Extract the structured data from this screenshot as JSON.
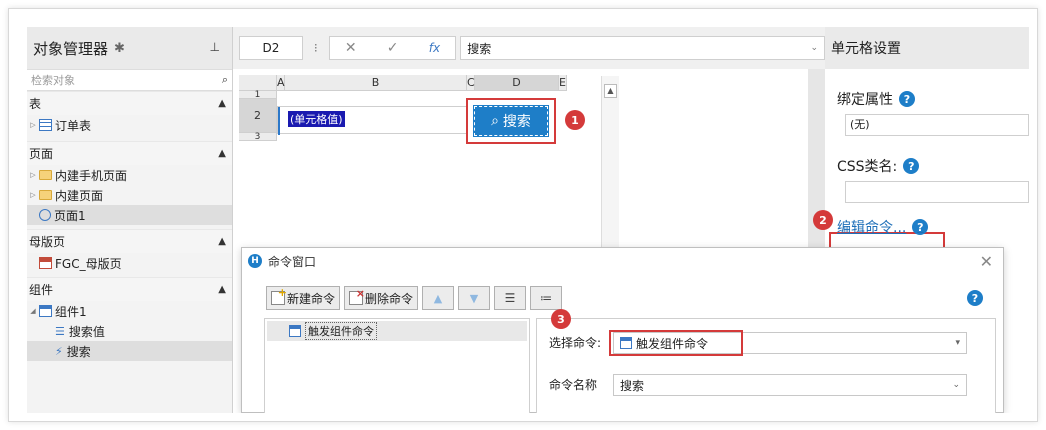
{
  "left_panel": {
    "title": "对象管理器",
    "search_placeholder": "检索对象",
    "sections": {
      "table": {
        "label": "表",
        "items": [
          "订单表"
        ]
      },
      "page": {
        "label": "页面",
        "items": [
          "内建手机页面",
          "内建页面",
          "页面1"
        ]
      },
      "master": {
        "label": "母版页",
        "items": [
          "FGC_母版页"
        ]
      },
      "component": {
        "label": "组件",
        "items": [
          "组件1",
          "搜索值",
          "搜索"
        ]
      }
    }
  },
  "formula_bar": {
    "cell_ref": "D2",
    "content": "搜索"
  },
  "grid": {
    "columns": [
      "A",
      "B",
      "C",
      "D",
      "E"
    ],
    "rows": [
      "1",
      "2",
      "3"
    ],
    "cell_b2": "(单元格值)",
    "button_label": "搜索"
  },
  "badges": [
    "1",
    "2",
    "3"
  ],
  "right_panel": {
    "title": "单元格设置",
    "binding_label": "绑定属性",
    "binding_value": "(无)",
    "css_label": "CSS类名:",
    "css_value": "",
    "edit_command_link": "编辑命令..."
  },
  "dialog": {
    "title": "命令窗口",
    "new_button": "新建命令",
    "delete_button": "删除命令",
    "command_item": "触发组件命令",
    "select_label": "选择命令:",
    "select_value": "触发组件命令",
    "name_label": "命令名称",
    "name_value": "搜索"
  },
  "colors": {
    "accent": "#1e7ec8",
    "highlight": "#d43a3a"
  }
}
